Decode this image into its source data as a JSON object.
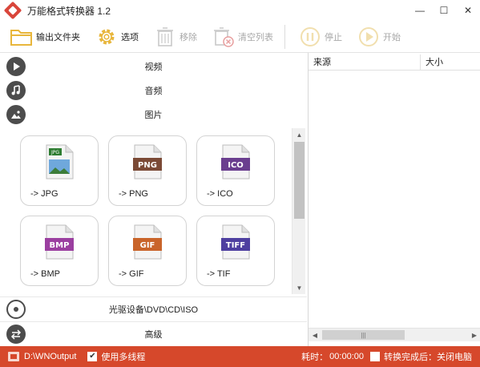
{
  "window": {
    "title": "万能格式转换器 1.2",
    "controls": {
      "minimize": "—",
      "maximize": "☐",
      "close": "✕"
    }
  },
  "toolbar": {
    "output_folder": "输出文件夹",
    "options": "选项",
    "remove": "移除",
    "clear_list": "清空列表",
    "stop": "停止",
    "start": "开始"
  },
  "categories": {
    "video": "视频",
    "audio": "音频",
    "image": "图片",
    "disc": "光驱设备\\DVD\\CD\\ISO",
    "advanced": "高级"
  },
  "formats": [
    {
      "badge": "JPG",
      "label": "-> JPG",
      "color": "#2e7d32"
    },
    {
      "badge": "PNG",
      "label": "-> PNG",
      "color": "#7b4a36"
    },
    {
      "badge": "ICO",
      "label": "-> ICO",
      "color": "#6a3e8f"
    },
    {
      "badge": "BMP",
      "label": "-> BMP",
      "color": "#9b3fa0"
    },
    {
      "badge": "GIF",
      "label": "-> GIF",
      "color": "#c9642a"
    },
    {
      "badge": "TIFF",
      "label": "-> TIF",
      "color": "#4e3fa0"
    }
  ],
  "file_list": {
    "columns": [
      "来源",
      "大小"
    ]
  },
  "status": {
    "output_path": "D:\\WNOutput",
    "multithread_label": "使用多线程",
    "multithread_checked": true,
    "elapsed_label": "耗时：",
    "elapsed_value": "00:00:00",
    "after_done_label": "转换完成后：关闭电脑",
    "after_done_checked": false
  },
  "colors": {
    "accent": "#d6482b",
    "toolbar_icon": "#e8b63c",
    "disabled_icon": "#c9c9c9"
  }
}
